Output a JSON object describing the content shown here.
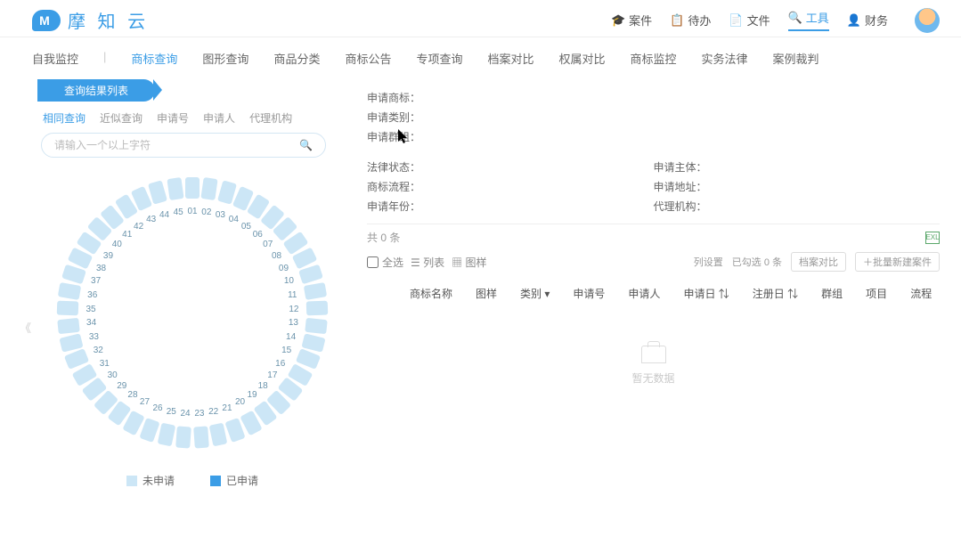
{
  "logo_text": "摩 知 云",
  "nav": {
    "cases": "案件",
    "todo": "待办",
    "files": "文件",
    "tools": "工具",
    "finance": "财务"
  },
  "subnav": {
    "self_monitor": "自我监控",
    "trademark_query": "商标查询",
    "graphic_query": "图形查询",
    "classify": "商品分类",
    "announce": "商标公告",
    "special": "专项查询",
    "archive": "档案对比",
    "rights": "权属对比",
    "monitor": "商标监控",
    "law": "实务法律",
    "judgment": "案例裁判"
  },
  "ribbon": "查询结果列表",
  "tabs": {
    "same": "相同查询",
    "approx": "近似查询",
    "appno": "申请号",
    "applicant": "申请人",
    "agency": "代理机构"
  },
  "search_placeholder": "请输入一个以上字符",
  "legend": {
    "unapplied": "未申请",
    "applied": "已申请"
  },
  "fields": {
    "apply_mark": "申请商标：",
    "apply_class": "申请类别：",
    "apply_group": "申请群组：",
    "legal_status": "法律状态：",
    "apply_subject": "申请主体：",
    "tm_process": "商标流程：",
    "apply_addr": "申请地址：",
    "apply_year": "申请年份：",
    "agency": "代理机构："
  },
  "count": "共 0 条",
  "toolbar": {
    "select_all": "全选",
    "list_view": "列表",
    "sample": "图样",
    "col_setting": "列设置",
    "checked": "已勾选 0 条",
    "compare": "档案对比",
    "bulk_new": "＋批量新建案件"
  },
  "columns": {
    "name": "商标名称",
    "sample": "图样",
    "class": "类别",
    "appno": "申请号",
    "applicant": "申请人",
    "appdate": "申请日",
    "regdate": "注册日",
    "group": "群组",
    "project": "项目",
    "process": "流程"
  },
  "empty": "暂无数据",
  "classes": [
    "01",
    "02",
    "03",
    "04",
    "05",
    "06",
    "07",
    "08",
    "09",
    "10",
    "11",
    "12",
    "13",
    "14",
    "15",
    "16",
    "17",
    "18",
    "19",
    "20",
    "21",
    "22",
    "23",
    "24",
    "25",
    "26",
    "27",
    "28",
    "29",
    "30",
    "31",
    "32",
    "33",
    "34",
    "35",
    "36",
    "37",
    "38",
    "39",
    "40",
    "41",
    "42",
    "43",
    "44",
    "45"
  ],
  "chev": "《"
}
